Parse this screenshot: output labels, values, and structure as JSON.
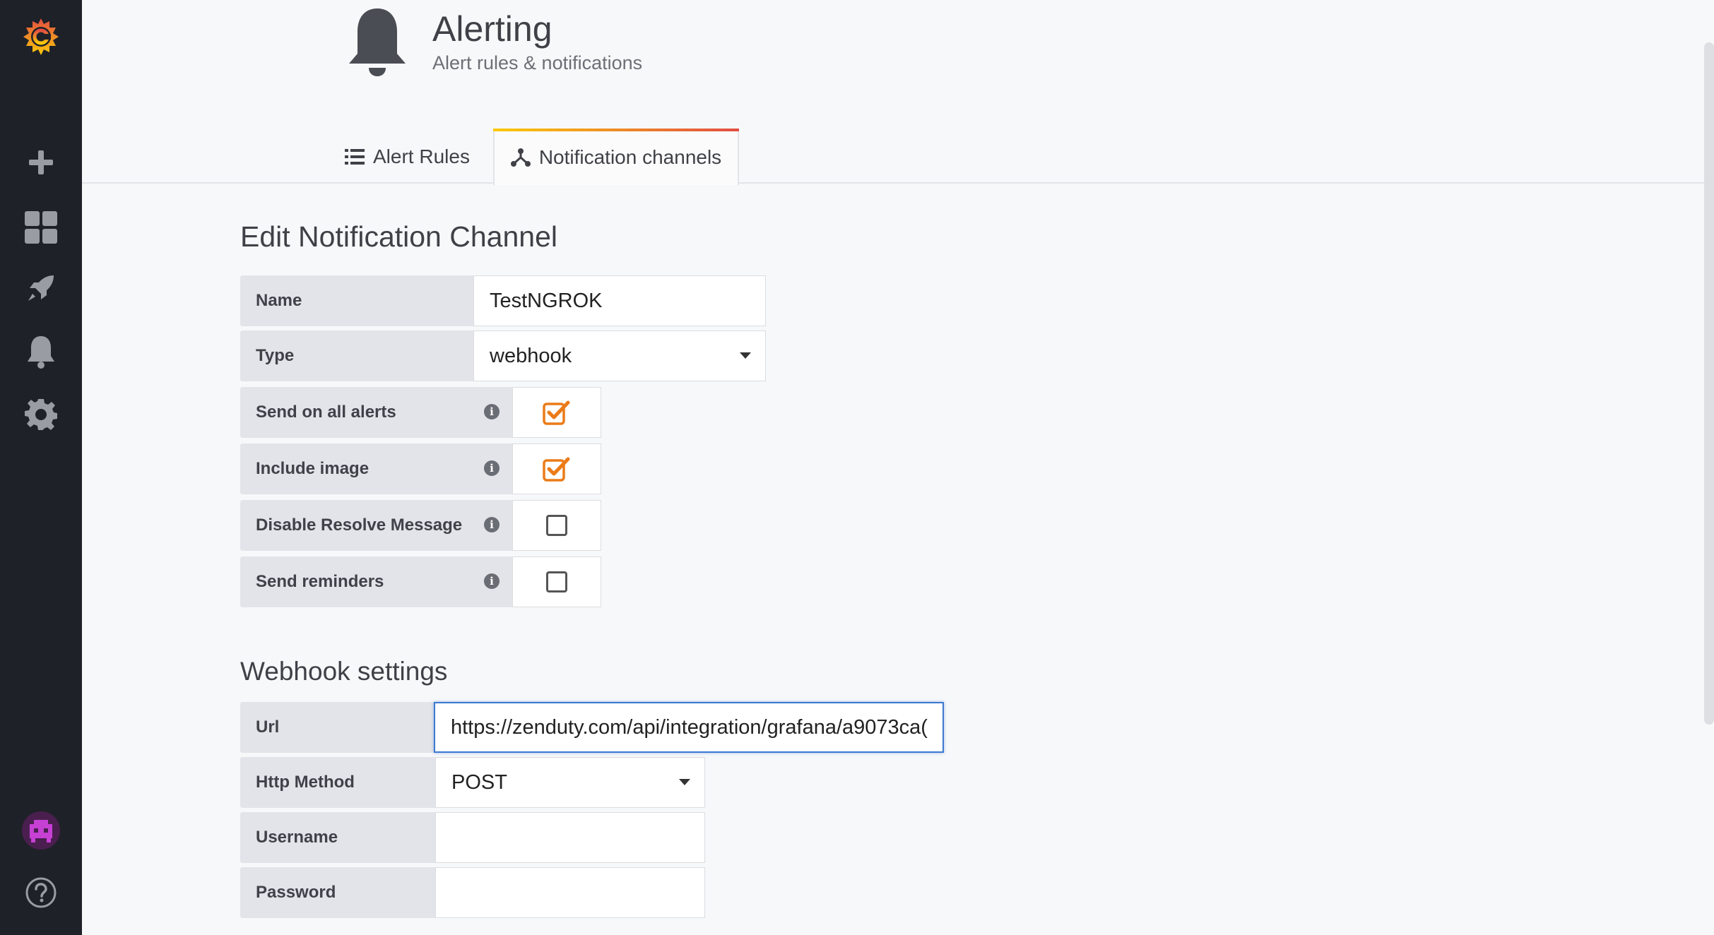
{
  "sidebar": {
    "logo_icon": "grafana-logo-icon",
    "items": [
      {
        "name": "create-plus-icon"
      },
      {
        "name": "dashboards-grid-icon"
      },
      {
        "name": "explore-rocket-icon"
      },
      {
        "name": "alerting-bell-icon"
      },
      {
        "name": "configuration-gear-icon"
      }
    ],
    "avatar_icon": "user-avatar",
    "help_icon": "help-question-icon"
  },
  "header": {
    "title": "Alerting",
    "subtitle": "Alert rules & notifications"
  },
  "tabs": [
    {
      "label": "Alert Rules",
      "icon": "list-icon",
      "active": false
    },
    {
      "label": "Notification channels",
      "icon": "share-nodes-icon",
      "active": true
    }
  ],
  "form": {
    "title": "Edit Notification Channel",
    "name_label": "Name",
    "name_value": "TestNGROK",
    "type_label": "Type",
    "type_value": "webhook",
    "checkboxes": [
      {
        "label": "Send on all alerts",
        "checked": true
      },
      {
        "label": "Include image",
        "checked": true
      },
      {
        "label": "Disable Resolve Message",
        "checked": false
      },
      {
        "label": "Send reminders",
        "checked": false
      }
    ]
  },
  "webhook": {
    "title": "Webhook settings",
    "url_label": "Url",
    "url_value": "https://zenduty.com/api/integration/grafana/a9073ca(",
    "method_label": "Http Method",
    "method_value": "POST",
    "username_label": "Username",
    "username_value": "",
    "password_label": "Password",
    "password_value": ""
  },
  "colors": {
    "accent": "#eb7b18",
    "sidebar_bg": "#1f2128",
    "focus": "#3c79d0"
  }
}
